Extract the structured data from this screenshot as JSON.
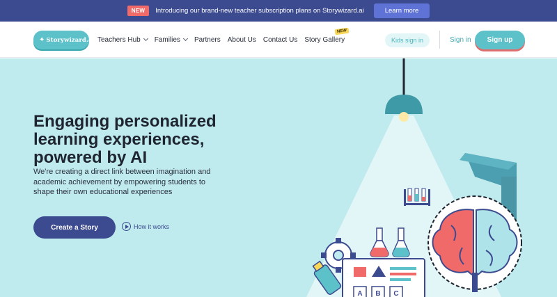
{
  "announcement": {
    "badge": "NEW",
    "message": "Introducing our brand-new teacher subscription plans on Storywizard.ai",
    "button": "Learn more"
  },
  "brand": {
    "logo_text": "Storywizard.ai"
  },
  "nav": {
    "items": [
      {
        "label": "Teachers Hub",
        "has_dropdown": true
      },
      {
        "label": "Families",
        "has_dropdown": true
      },
      {
        "label": "Partners",
        "has_dropdown": false
      },
      {
        "label": "About Us",
        "has_dropdown": false
      },
      {
        "label": "Contact Us",
        "has_dropdown": false
      },
      {
        "label": "Story Gallery",
        "has_dropdown": false,
        "tag": "NEW"
      }
    ]
  },
  "auth": {
    "kids_sign_in": "Kids sign in",
    "sign_in": "Sign in",
    "sign_up": "Sign up"
  },
  "hero": {
    "title": "Engaging personalized learning experiences, powered by AI",
    "subtitle": "We're creating a direct link between imagination and academic achievement by empowering students to shape their own educational experiences",
    "cta": "Create a Story",
    "secondary": "How it works"
  },
  "illustration": {
    "board_letters": [
      "A",
      "B",
      "C"
    ]
  },
  "colors": {
    "announce_bg": "#3c4a8f",
    "accent_teal": "#5cc1c9",
    "hero_bg": "#bfeaee",
    "primary_navy": "#3c4a8f",
    "badge_red": "#f06a6a",
    "tag_yellow": "#f8d657"
  },
  "icons": [
    "magic-wand-icon",
    "chevron-down-icon",
    "play-circle-icon"
  ]
}
